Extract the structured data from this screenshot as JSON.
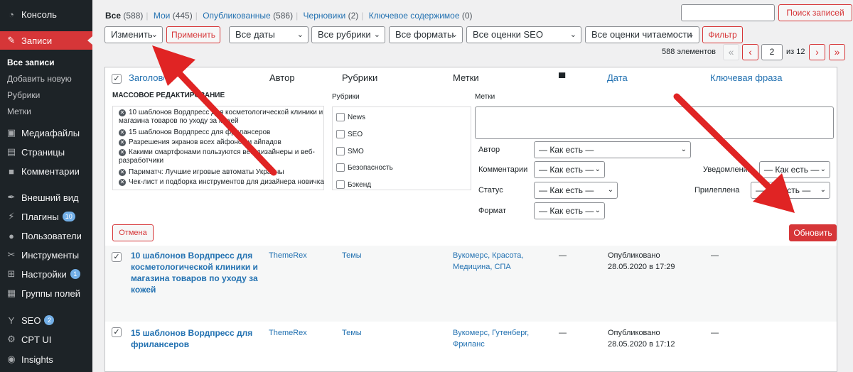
{
  "sidebar": {
    "menu": [
      {
        "label": "Консоль",
        "icon": "dashboard-icon"
      },
      {
        "label": "Записи",
        "icon": "pin-icon",
        "active": true
      },
      {
        "label": "Медиафайлы",
        "icon": "media-icon"
      },
      {
        "label": "Страницы",
        "icon": "pages-icon"
      },
      {
        "label": "Комментарии",
        "icon": "comments-icon"
      },
      {
        "label": "Внешний вид",
        "icon": "appearance-icon"
      },
      {
        "label": "Плагины",
        "icon": "plugins-icon",
        "badge": "10"
      },
      {
        "label": "Пользователи",
        "icon": "users-icon"
      },
      {
        "label": "Инструменты",
        "icon": "tools-icon"
      },
      {
        "label": "Настройки",
        "icon": "settings-icon",
        "badge": "1"
      },
      {
        "label": "Группы полей",
        "icon": "field-groups-icon"
      },
      {
        "label": "SEO",
        "icon": "seo-icon",
        "badge": "2"
      },
      {
        "label": "CPT UI",
        "icon": "cpt-icon"
      },
      {
        "label": "Insights",
        "icon": "insights-icon"
      }
    ],
    "submenu": [
      "Все записи",
      "Добавить новую",
      "Рубрики",
      "Метки"
    ]
  },
  "filters": {
    "all_label": "Все",
    "all_count": "(588)",
    "mine_label": "Мои",
    "mine_count": "(445)",
    "published_label": "Опубликованные",
    "published_count": "(586)",
    "drafts_label": "Черновики",
    "drafts_count": "(2)",
    "cornerstone_label": "Ключевое содержимое",
    "cornerstone_count": "(0)"
  },
  "search": {
    "value": "",
    "button": "Поиск записей"
  },
  "toolbar": {
    "bulk_action": "Изменить",
    "apply": "Применить",
    "dates": "Все даты",
    "categories": "Все рубрики",
    "formats": "Все форматы",
    "seo": "Все оценки SEO",
    "readability": "Все оценки читаемости",
    "filter": "Фильтр"
  },
  "pagination": {
    "count": "588 элементов",
    "first": "«",
    "prev": "‹",
    "page": "2",
    "of": "из 12",
    "next": "›",
    "last": "»"
  },
  "columns": {
    "title": "Заголовок",
    "author": "Автор",
    "categories": "Рубрики",
    "tags": "Метки",
    "date": "Дата",
    "keyphrase": "Ключевая фраза"
  },
  "bulk_edit": {
    "heading": "МАССОВОЕ РЕДАКТИРОВАНИЕ",
    "items": [
      "10 шаблонов Вордпресс для косметологической клиники и магазина товаров по уходу за кожей",
      "15 шаблонов Вордпресс для фрилансеров",
      "Разрешения экранов всех айфонов и айпадов",
      "Какими смартфонами пользуются веб-дизайнеры и веб-разработчики",
      "Париматч: Лучшие игровые автоматы Украины",
      "Чек-лист и подборка инструментов для дизайнера новичка"
    ],
    "categories_label": "Рубрики",
    "categories": [
      "News",
      "SEO",
      "SMO",
      "Безопасность",
      "Бэкенд"
    ],
    "tags_label": "Метки",
    "author_label": "Автор",
    "author_value": "— Как есть —",
    "comments_label": "Комментарии",
    "comments_value": "— Как есть —",
    "status_label": "Статус",
    "status_value": "— Как есть —",
    "format_label": "Формат",
    "format_value": "— Как есть —",
    "notify_label": "Уведомления",
    "notify_value": "— Как есть —",
    "sticky_label": "Прилеплена",
    "sticky_value": "— Как есть —",
    "cancel": "Отмена",
    "update": "Обновить"
  },
  "rows": [
    {
      "title": "10 шаблонов Вордпресс для косметологической клиники и магазина товаров по уходу за кожей",
      "author": "ThemeRex",
      "categories": "Темы",
      "tags": "Вукомерс, Красота, Медицина, СПА",
      "comments": "—",
      "date_status": "Опубликовано",
      "date": "28.05.2020 в 17:29",
      "keyphrase": "—"
    },
    {
      "title": "15 шаблонов Вордпресс для фрилансеров",
      "author": "ThemeRex",
      "categories": "Темы",
      "tags": "Вукомерс, Гутенберг, Фриланс",
      "comments": "—",
      "date_status": "Опубликовано",
      "date": "28.05.2020 в 17:12",
      "keyphrase": "—"
    }
  ],
  "colors": {
    "accent": "#d63638",
    "link": "#2271b1",
    "sidebar": "#1d2327",
    "annotation_arrow": "#e02424"
  }
}
